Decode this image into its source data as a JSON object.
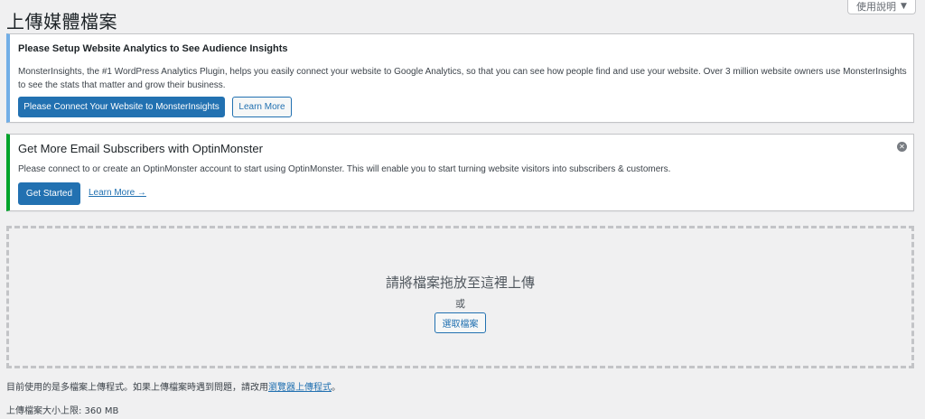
{
  "page": {
    "title": "上傳媒體檔案"
  },
  "help": {
    "label": "使用說明",
    "caret": "▼"
  },
  "monsterinsights": {
    "title": "Please Setup Website Analytics to See Audience Insights",
    "text": "MonsterInsights, the #1 WordPress Analytics Plugin, helps you easily connect your website to Google Analytics, so that you can see how people find and use your website. Over 3 million website owners use MonsterInsights to see the stats that matter and grow their business.",
    "connect_label": "Please Connect Your Website to MonsterInsights",
    "learn_label": "Learn More",
    "accent": "#72aee6"
  },
  "optinmonster": {
    "title": "Get More Email Subscribers with OptinMonster",
    "text": "Please connect to or create an OptinMonster account to start using OptinMonster. This will enable you to start turning website visitors into subscribers & customers.",
    "start_label": "Get Started",
    "learn_label": "Learn More →",
    "close_glyph": "✕",
    "accent": "#00a32a"
  },
  "dropzone": {
    "title": "請將檔案拖放至這裡上傳",
    "or": "或",
    "select_label": "選取檔案"
  },
  "uploader": {
    "info_prefix": "目前使用的是多檔案上傳程式。如果上傳檔案時遇到問題，請改用",
    "info_link": "瀏覽器上傳程式",
    "info_suffix": "。",
    "max_size": "上傳檔案大小上限: 360 MB"
  }
}
